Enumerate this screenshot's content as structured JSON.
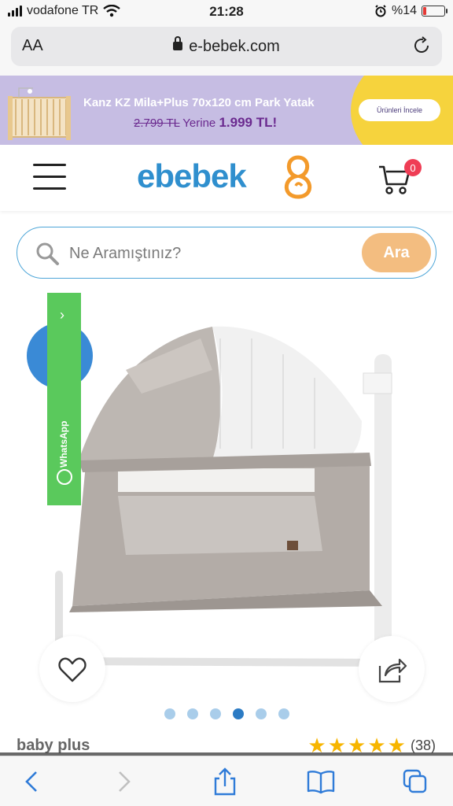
{
  "status_bar": {
    "carrier": "vodafone TR",
    "time": "21:28",
    "battery": "%14"
  },
  "browser": {
    "text_size_label": "AA",
    "address": "e-bebek.com"
  },
  "promo": {
    "title": "Kanz KZ Mila+Plus 70x120 cm Park Yatak",
    "old_price": "2.799 TL",
    "instead_word": "Yerine",
    "new_price": "1.999 TL!",
    "cta": "Ürünleri İncele"
  },
  "header": {
    "logo_text": "ebebek",
    "cart_count": "0"
  },
  "search": {
    "placeholder": "Ne Aramıştınız?",
    "button": "Ara"
  },
  "whatsapp": {
    "label": "WhatsApp"
  },
  "carousel": {
    "total": 6,
    "active_index": 3
  },
  "product": {
    "brand": "baby plus",
    "rating": 5,
    "review_count": "(38)"
  },
  "colors": {
    "brand_blue": "#2f8fce",
    "brand_orange": "#f39a2b",
    "banner_purple": "#c6bde3",
    "banner_yellow": "#f6d33d",
    "search_button": "#f3bd80",
    "whatsapp_green": "#5ac95c",
    "badge_red": "#ef3d55",
    "star": "#f7b500"
  }
}
